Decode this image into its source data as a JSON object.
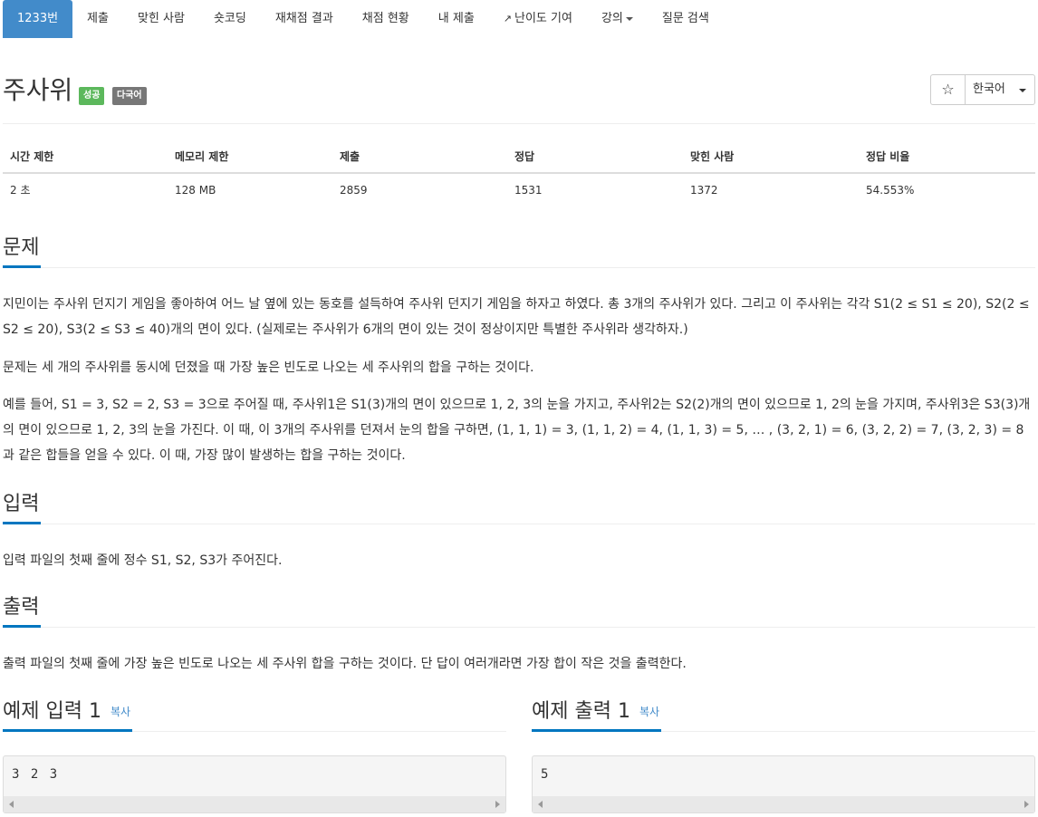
{
  "nav": {
    "tabs": [
      {
        "label": "1233번"
      },
      {
        "label": "제출"
      },
      {
        "label": "맞힌 사람"
      },
      {
        "label": "숏코딩"
      },
      {
        "label": "재채점 결과"
      },
      {
        "label": "채점 현황"
      },
      {
        "label": "내 제출"
      },
      {
        "label": "난이도 기여"
      },
      {
        "label": "강의"
      },
      {
        "label": "질문 검색"
      }
    ]
  },
  "problem": {
    "title": "주사위",
    "badge_success": "성공",
    "badge_multilang": "다국어",
    "language": "한국어",
    "star": "☆"
  },
  "info": {
    "headers": [
      "시간 제한",
      "메모리 제한",
      "제출",
      "정답",
      "맞힌 사람",
      "정답 비율"
    ],
    "values": [
      "2 초",
      "128 MB",
      "2859",
      "1531",
      "1372",
      "54.553%"
    ]
  },
  "sections": {
    "description_title": "문제",
    "description": [
      "지민이는 주사위 던지기 게임을 좋아하여 어느 날 옆에 있는 동호를 설득하여 주사위 던지기 게임을 하자고 하였다. 총 3개의 주사위가 있다. 그리고 이 주사위는 각각 S1(2 ≤ S1 ≤ 20), S2(2 ≤ S2 ≤ 20), S3(2 ≤ S3 ≤ 40)개의 면이 있다. (실제로는 주사위가 6개의 면이 있는 것이 정상이지만 특별한 주사위라 생각하자.)",
      "문제는 세 개의 주사위를 동시에 던졌을 때 가장 높은 빈도로 나오는 세 주사위의 합을 구하는 것이다.",
      "예를 들어, S1 = 3, S2 = 2, S3 = 3으로 주어질 때, 주사위1은 S1(3)개의 면이 있으므로 1, 2, 3의 눈을 가지고, 주사위2는 S2(2)개의 면이 있으므로 1, 2의 눈을 가지며, 주사위3은 S3(3)개의 면이 있으므로 1, 2, 3의 눈을 가진다. 이 때, 이 3개의 주사위를 던져서 눈의 합을 구하면, (1, 1, 1) = 3, (1, 1, 2) = 4, (1, 1, 3) = 5, … , (3, 2, 1) = 6, (3, 2, 2) = 7, (3, 2, 3) = 8과 같은 합들을 얻을 수 있다. 이 때, 가장 많이 발생하는 합을 구하는 것이다."
    ],
    "input_title": "입력",
    "input": "입력 파일의 첫째 줄에 정수 S1, S2, S3가 주어진다.",
    "output_title": "출력",
    "output": "출력 파일의 첫째 줄에 가장 높은 빈도로 나오는 세 주사위 합을 구하는 것이다. 단 답이 여러개라면 가장 합이 작은 것을 출력한다."
  },
  "samples": {
    "input_title": "예제 입력 1",
    "output_title": "예제 출력 1",
    "copy_label": "복사",
    "input_value": "3 2 3",
    "output_value": "5"
  }
}
